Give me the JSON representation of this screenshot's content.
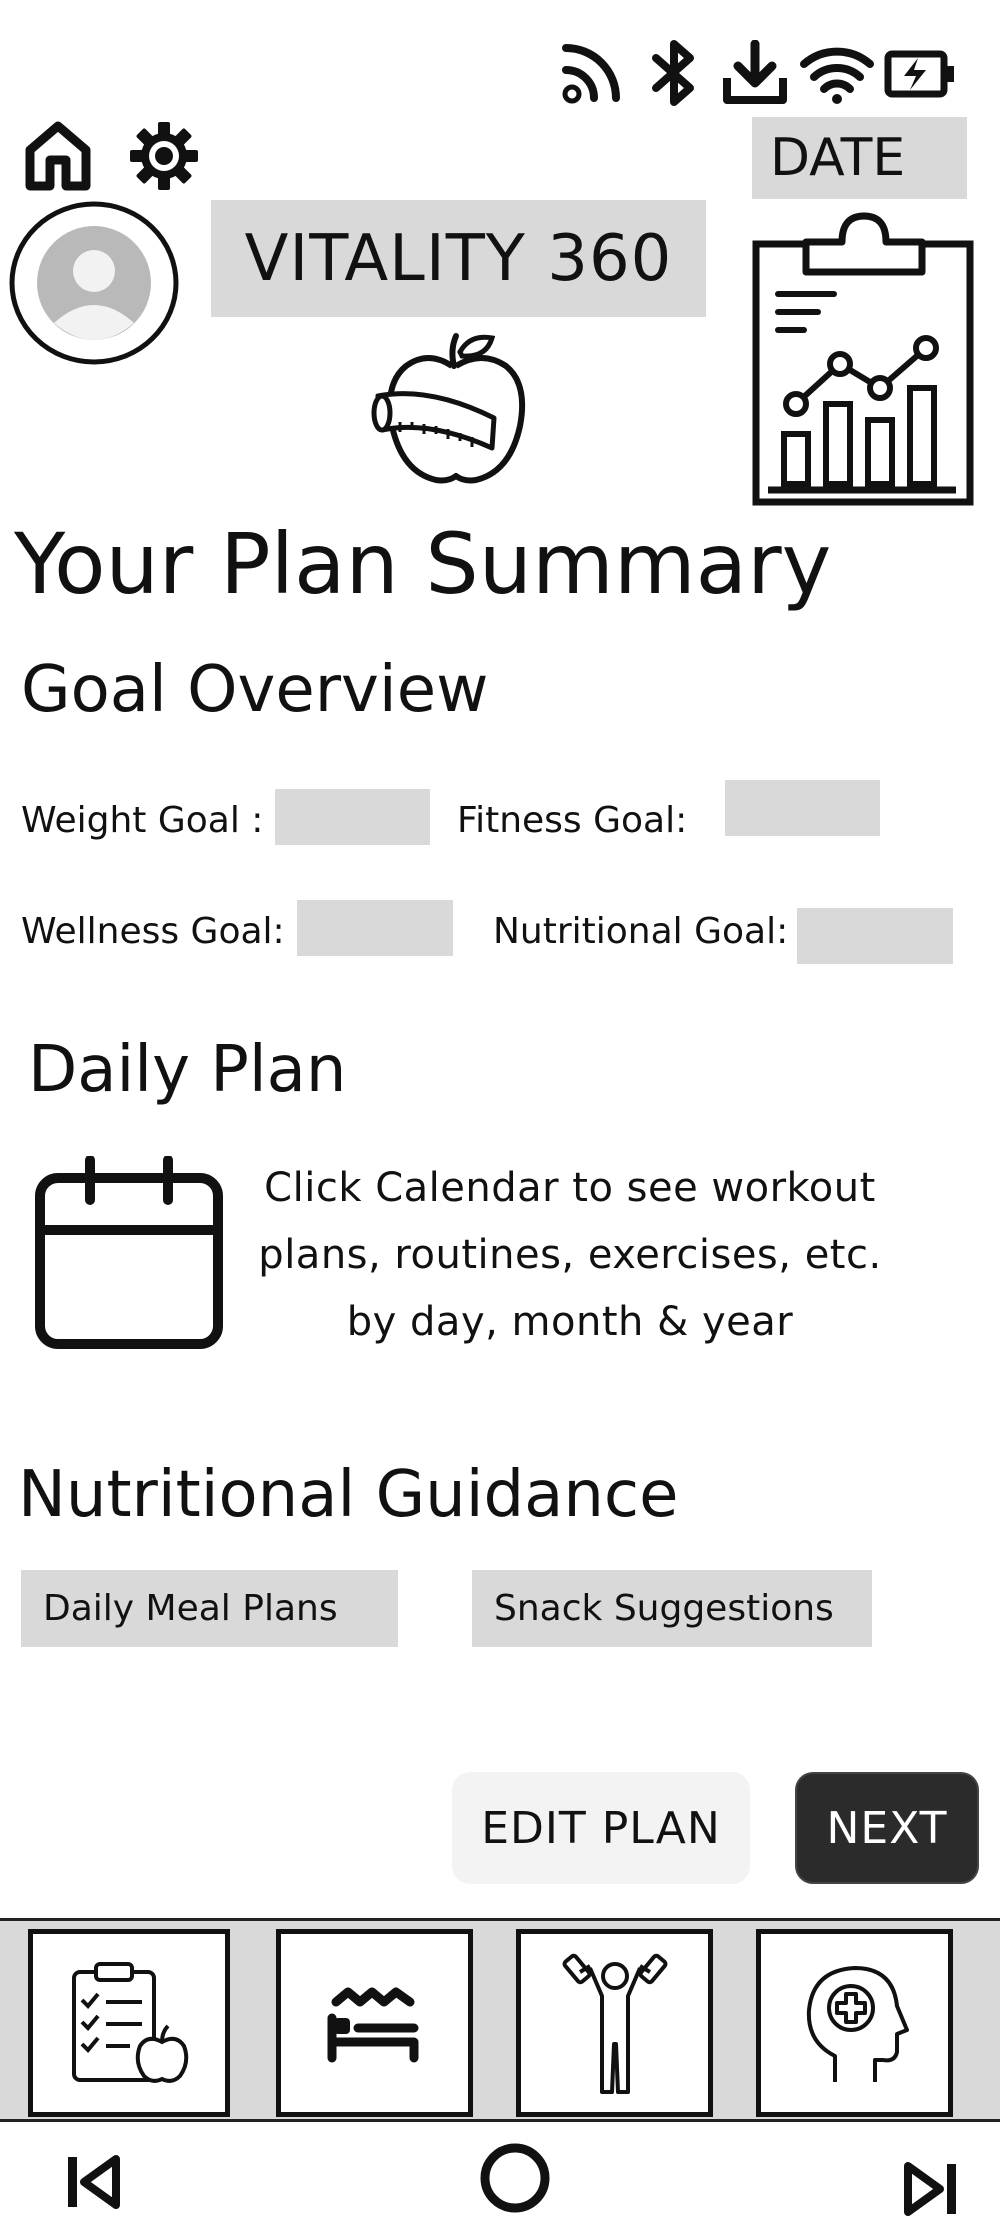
{
  "status_bar": {
    "icons": [
      "cast-icon",
      "bluetooth-icon",
      "download-icon",
      "wifi-icon",
      "battery-charging-icon"
    ]
  },
  "header": {
    "app_title": "VITALITY 360",
    "date_label": "DATE",
    "icons": [
      "home-icon",
      "gear-icon",
      "avatar",
      "apple-measuring-tape-icon",
      "clipboard-chart-icon"
    ]
  },
  "page": {
    "title": "Your Plan Summary"
  },
  "goal_overview": {
    "title": "Goal Overview",
    "goals": [
      {
        "label": "Weight Goal :",
        "value": ""
      },
      {
        "label": "Fitness Goal:",
        "value": ""
      },
      {
        "label": "Wellness Goal:",
        "value": ""
      },
      {
        "label": "Nutritional Goal:",
        "value": ""
      }
    ]
  },
  "daily_plan": {
    "title": "Daily Plan",
    "line1": "Click Calendar to see workout",
    "line2": "plans, routines, exercises, etc.",
    "line3": "by day, month & year"
  },
  "nutritional_guidance": {
    "title": "Nutritional Guidance",
    "options": [
      "Daily Meal Plans",
      "Snack Suggestions"
    ]
  },
  "actions": {
    "edit_label": "EDIT PLAN",
    "next_label": "NEXT"
  },
  "tab_bar": {
    "tabs": [
      "plan-tab",
      "sleep-tab",
      "fitness-tab",
      "mental-health-tab"
    ]
  },
  "nav_bar": {
    "icons": [
      "skip-back-icon",
      "home-circle-icon",
      "skip-forward-icon"
    ]
  },
  "colors": {
    "field_gray": "#d9d9d9",
    "primary_dark": "#2b2b2b",
    "text": "#111111"
  }
}
